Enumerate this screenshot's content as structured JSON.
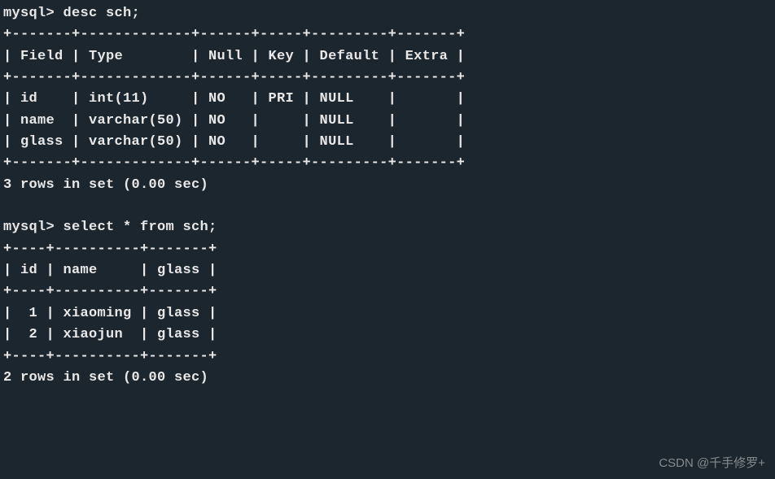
{
  "prompt": "mysql>",
  "commands": {
    "desc": "desc sch;",
    "select": "select * from sch;"
  },
  "desc_table": {
    "border_top": "+-------+-------------+------+-----+---------+-------+",
    "header": "| Field | Type        | Null | Key | Default | Extra |",
    "border_mid": "+-------+-------------+------+-----+---------+-------+",
    "rows": [
      "| id    | int(11)     | NO   | PRI | NULL    |       |",
      "| name  | varchar(50) | NO   |     | NULL    |       |",
      "| glass | varchar(50) | NO   |     | NULL    |       |"
    ],
    "border_bot": "+-------+-------------+------+-----+---------+-------+",
    "summary": "3 rows in set (0.00 sec)"
  },
  "select_table": {
    "border_top": "+----+----------+-------+",
    "header": "| id | name     | glass |",
    "border_mid": "+----+----------+-------+",
    "rows": [
      "|  1 | xiaoming | glass |",
      "|  2 | xiaojun  | glass |"
    ],
    "border_bot": "+----+----------+-------+",
    "summary": "2 rows in set (0.00 sec)"
  },
  "watermark": "CSDN @千手修罗+",
  "chart_data": {
    "type": "table",
    "desc_sch": {
      "columns": [
        "Field",
        "Type",
        "Null",
        "Key",
        "Default",
        "Extra"
      ],
      "rows": [
        [
          "id",
          "int(11)",
          "NO",
          "PRI",
          "NULL",
          ""
        ],
        [
          "name",
          "varchar(50)",
          "NO",
          "",
          "NULL",
          ""
        ],
        [
          "glass",
          "varchar(50)",
          "NO",
          "",
          "NULL",
          ""
        ]
      ]
    },
    "select_sch": {
      "columns": [
        "id",
        "name",
        "glass"
      ],
      "rows": [
        [
          1,
          "xiaoming",
          "glass"
        ],
        [
          2,
          "xiaojun",
          "glass"
        ]
      ]
    }
  }
}
